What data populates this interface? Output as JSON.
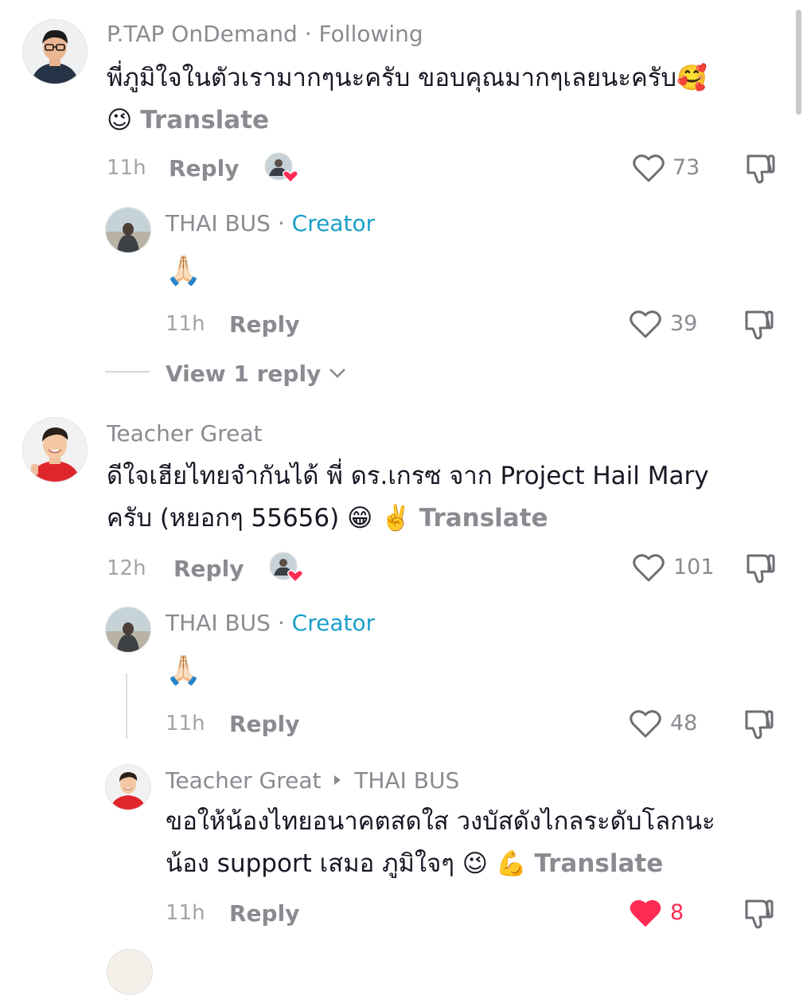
{
  "comments": [
    {
      "username": "P.TAP OnDemand",
      "separator": "·",
      "tag": "Following",
      "text": "พี่ภูมิใจในตัวเรามากๆนะครับ ขอบคุณมากๆเลยนะครับ🥰",
      "text2": "😉",
      "translate": "Translate",
      "time": "11h",
      "reply": "Reply",
      "likes": "73",
      "reply_item": {
        "username": "THAI BUS",
        "separator": "·",
        "tag": "Creator",
        "text": "🙏🏻",
        "time": "11h",
        "reply": "Reply",
        "likes": "39"
      },
      "view_replies": "View 1 reply"
    },
    {
      "username": "Teacher Great",
      "text": "ดีใจเฮียไทยจำกันได้ พี่ ดร.เกรซ จาก Project Hail Mary",
      "text2": "ครับ (หยอกๆ 55656) 😁 ✌️",
      "translate": "Translate",
      "time": "12h",
      "reply": "Reply",
      "likes": "101",
      "replies": [
        {
          "username": "THAI BUS",
          "separator": "·",
          "tag": "Creator",
          "text": "🙏🏻",
          "time": "11h",
          "reply": "Reply",
          "likes": "48"
        },
        {
          "username": "Teacher Great",
          "reply_to": "THAI BUS",
          "text": "ขอให้น้องไทยอนาคตสดใส วงบัสดังไกลระดับโลกนะ",
          "text2": "น้อง support เสมอ ภูมิใจๆ 😉 💪",
          "translate": "Translate",
          "time": "11h",
          "reply": "Reply",
          "likes": "8",
          "liked": true
        }
      ]
    }
  ],
  "colors": {
    "secondary_text": "#8a8b91",
    "creator_tag": "#1a9fc8",
    "like_active": "#fe2c55"
  },
  "icons": [
    "heart-outline-icon",
    "heart-filled-icon",
    "dislike-icon",
    "chevron-down-icon",
    "caret-right-icon",
    "creator-liked-avatar-icon"
  ]
}
